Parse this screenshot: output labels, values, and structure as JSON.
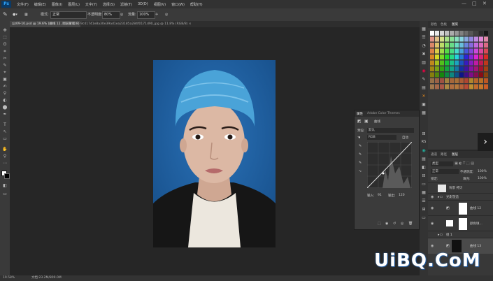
{
  "app": {
    "logo": "Ps"
  },
  "menu": [
    "文件(F)",
    "编辑(E)",
    "图像(I)",
    "图层(L)",
    "文字(Y)",
    "选择(S)",
    "滤镜(T)",
    "3D(D)",
    "视图(V)",
    "窗口(W)",
    "帮助(H)"
  ],
  "window_controls": {
    "min": "—",
    "max": "□",
    "close": "✕"
  },
  "options": {
    "mode_label": "模式:",
    "mode_value": "正常",
    "opacity_label": "不透明度:",
    "opacity_value": "80%",
    "flow_label": "流量:",
    "flow_value": "100%"
  },
  "tabs": [
    {
      "label": "zjz09-10.psd @ 19.6% (曲线 12, 图层蒙版/8) ×",
      "active": true
    },
    {
      "label": "9c41741e8a30e39ad1ea23185a284f0171d90_jpg @ 11.8% (RGB/8) ×",
      "active": false
    }
  ],
  "tools": [
    "✥",
    "⬚",
    "ʘ",
    "⌗",
    "✂",
    "✎",
    "⌖",
    "▣",
    "✍",
    "⚲",
    "◐",
    "⬤",
    "✒",
    "T",
    "↖",
    "▭",
    "✋",
    "⚲",
    "⋯",
    "◧"
  ],
  "statusbar": {
    "zoom": "19.58%",
    "doc": "文档:23.2M/809.0M"
  },
  "swatches_panel": {
    "tabs": [
      "颜色",
      "色板",
      "图案"
    ],
    "active": 2
  },
  "colors": {
    "photo_bg": "#1f5fa0",
    "cap": "#4aa3d8",
    "jacket": "#1a1a1a",
    "shirt": "#efeae1",
    "skin": "#d8b39f"
  },
  "properties": {
    "tabs": [
      "属性",
      "Adobe Color Themes"
    ],
    "adjust_label": "曲线",
    "preset_label": "预设:",
    "preset_value": "默认",
    "channel_value": "RGB",
    "auto_label": "自动",
    "input_label": "输入:",
    "input_value": "91",
    "output_label": "输出:",
    "output_value": "120"
  },
  "layers": {
    "tabs": [
      "通道",
      "路径",
      "图层"
    ],
    "kind": "类型",
    "blend": "正常",
    "opacity_label": "不透明度:",
    "opacity_value": "100%",
    "lock_label": "锁定:",
    "fill_label": "填充:",
    "fill_value": "100%",
    "rows": [
      {
        "name": "背景 拷贝",
        "thumb": "#e8e8e8"
      },
      {
        "name": "光影塑造",
        "thumb": "#444"
      },
      {
        "name": "曲线 12",
        "thumb": "#ffffff"
      },
      {
        "name": "颜色填...",
        "thumb": "#ffffff"
      },
      {
        "name": "组 1",
        "thumb": "#444"
      },
      {
        "name": "曲线 13",
        "thumb": "#111"
      }
    ]
  },
  "watermark": {
    "text": "UiBQ.CoM"
  }
}
